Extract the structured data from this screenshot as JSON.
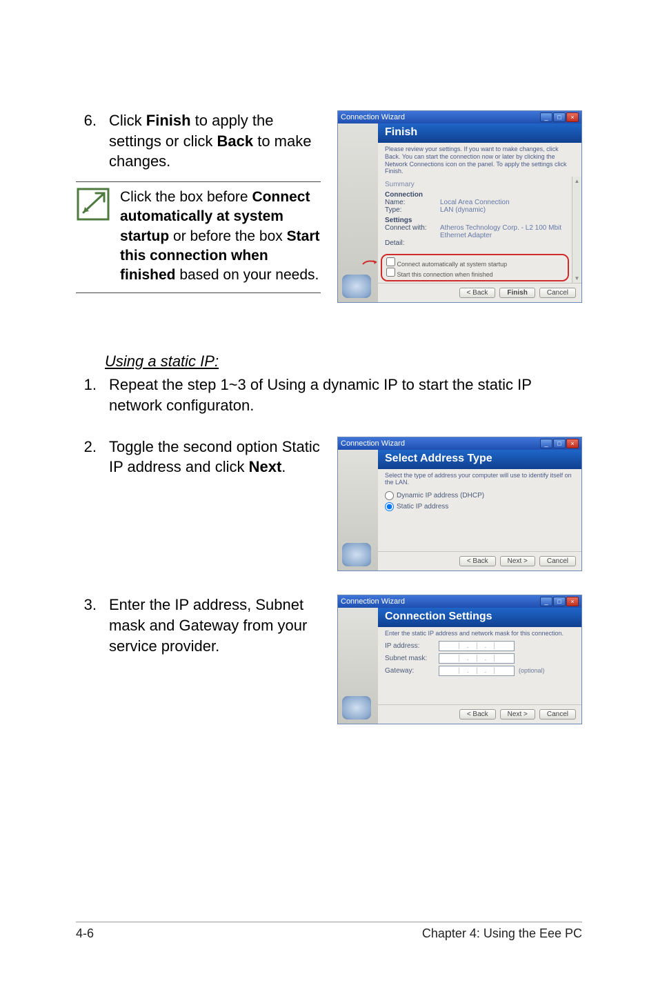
{
  "steps_main": {
    "s6": {
      "num": "6.",
      "body_a": "Click ",
      "body_b": "Finish",
      "body_c": " to apply the settings or click ",
      "body_d": "Back",
      "body_e": " to make changes."
    },
    "note": {
      "a": "Click the box before ",
      "b": "Connect automatically at system startup",
      "c": " or before the box ",
      "d": "Start this connection when finished",
      "e": " based on your needs."
    }
  },
  "section_static": {
    "title": "Using a static IP:",
    "s1": {
      "num": "1.",
      "body": "Repeat the step 1~3 of Using a dynamic IP to start the static IP network configuraton."
    },
    "s2": {
      "num": "2.",
      "body_a": "Toggle the second option Static IP address and click ",
      "body_b": "Next",
      "body_c": "."
    },
    "s3": {
      "num": "3.",
      "body": "Enter the IP address, Subnet mask and Gateway from your service provider."
    }
  },
  "footer": {
    "left": "4-6",
    "right": "Chapter 4: Using the Eee PC"
  },
  "wizard_finish": {
    "title": "Connection Wizard",
    "banner": "Finish",
    "desc": "Please review your settings. If you want to make changes, click Back. You can start the connection now or later by clicking the Network Connections icon on the panel. To apply the settings click Finish.",
    "summary": "Summary",
    "group_connection": "Connection",
    "rows": {
      "name_k": "Name:",
      "name_v": "Local Area Connection",
      "type_k": "Type:",
      "type_v": "LAN (dynamic)"
    },
    "group_settings": "Settings",
    "rows2": {
      "conn_k": "Connect with:",
      "conn_v": "Atheros Technology Corp. - L2 100 Mbit Ethernet Adapter",
      "det_k": "Detail:"
    },
    "chk1": "Connect automatically at system startup",
    "chk2": "Start this connection when finished",
    "btn_back": "< Back",
    "btn_finish": "Finish",
    "btn_cancel": "Cancel"
  },
  "wizard_addrtype": {
    "title": "Connection Wizard",
    "banner": "Select Address Type",
    "desc": "Select the type of address your computer will use to identify itself on the LAN.",
    "opt1": "Dynamic IP address (DHCP)",
    "opt2": "Static IP address",
    "btn_back": "< Back",
    "btn_next": "Next >",
    "btn_cancel": "Cancel"
  },
  "wizard_connset": {
    "title": "Connection Wizard",
    "banner": "Connection Settings",
    "desc": "Enter the static IP address and network mask for this connection.",
    "ip_label": "IP address:",
    "mask_label": "Subnet mask:",
    "gw_label": "Gateway:",
    "optional": "(optional)",
    "btn_back": "< Back",
    "btn_next": "Next >",
    "btn_cancel": "Cancel"
  }
}
